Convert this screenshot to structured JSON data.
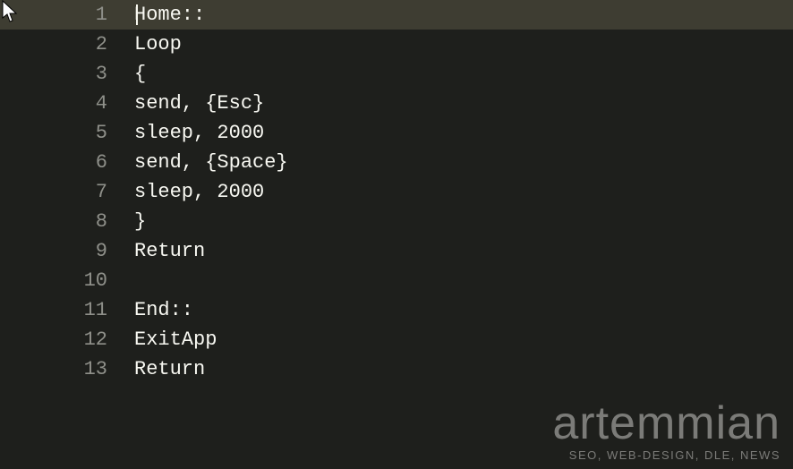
{
  "editor": {
    "currentLine": 1,
    "lines": [
      {
        "num": "1",
        "text": "Home::"
      },
      {
        "num": "2",
        "text": "Loop"
      },
      {
        "num": "3",
        "text": "{"
      },
      {
        "num": "4",
        "text": "send, {Esc}"
      },
      {
        "num": "5",
        "text": "sleep, 2000"
      },
      {
        "num": "6",
        "text": "send, {Space}"
      },
      {
        "num": "7",
        "text": "sleep, 2000"
      },
      {
        "num": "8",
        "text": "}"
      },
      {
        "num": "9",
        "text": "Return"
      },
      {
        "num": "10",
        "text": ""
      },
      {
        "num": "11",
        "text": "End::"
      },
      {
        "num": "12",
        "text": "ExitApp"
      },
      {
        "num": "13",
        "text": "Return"
      }
    ]
  },
  "watermark": {
    "brand": "artemmian",
    "tagline": "SEO, WEB-DESIGN, DLE, NEWS"
  }
}
